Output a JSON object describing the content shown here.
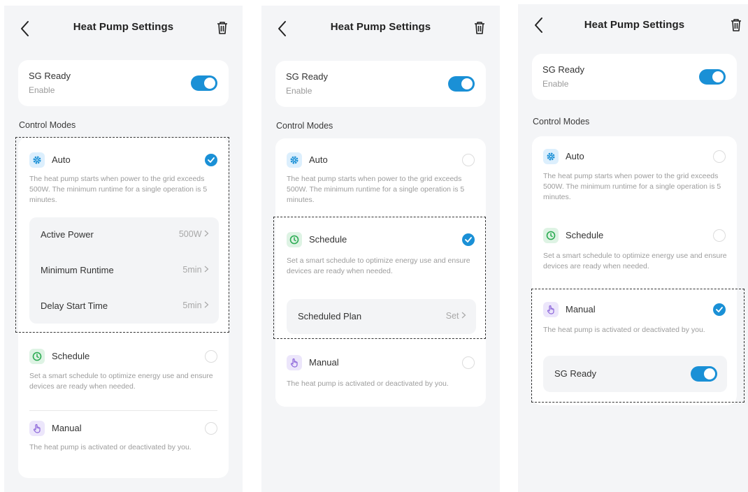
{
  "colors": {
    "accent": "#1a90d6",
    "background": "#f4f5f7",
    "card": "#ffffff",
    "auto_icon_bg": "#dceffd",
    "schedule_icon_bg": "#def3e4",
    "schedule_icon": "#2bab52",
    "manual_icon_bg": "#ece6fb",
    "manual_icon": "#8a63d9"
  },
  "icons": {
    "back": "chevron-left-icon",
    "delete": "trash-icon",
    "auto": "gear-icon",
    "schedule": "clock-icon",
    "manual": "hand-pointer-icon",
    "selected": "check-icon"
  },
  "header": {
    "title": "Heat Pump Settings"
  },
  "sg_ready": {
    "title": "SG Ready",
    "subtitle": "Enable",
    "enabled": true
  },
  "control_modes_label": "Control Modes",
  "modes": {
    "auto": {
      "title": "Auto",
      "desc": "The heat pump starts when power to the grid exceeds 500W. The minimum runtime for a single operation is 5 minutes."
    },
    "schedule": {
      "title": "Schedule",
      "desc": "Set a smart schedule to optimize energy use and ensure devices are ready when needed."
    },
    "manual": {
      "title": "Manual",
      "desc": "The heat pump is activated or deactivated by you."
    }
  },
  "auto_settings": [
    {
      "label": "Active Power",
      "value": "500W"
    },
    {
      "label": "Minimum Runtime",
      "value": "5min"
    },
    {
      "label": "Delay Start Time",
      "value": "5min"
    }
  ],
  "schedule_settings": {
    "label": "Scheduled Plan",
    "value": "Set"
  },
  "manual_settings": {
    "label": "SG Ready",
    "enabled": true
  },
  "screens": [
    {
      "name": "screen-auto-selected",
      "selected_mode": "Auto"
    },
    {
      "name": "screen-schedule-selected",
      "selected_mode": "Schedule"
    },
    {
      "name": "screen-manual-selected",
      "selected_mode": "Manual"
    }
  ]
}
